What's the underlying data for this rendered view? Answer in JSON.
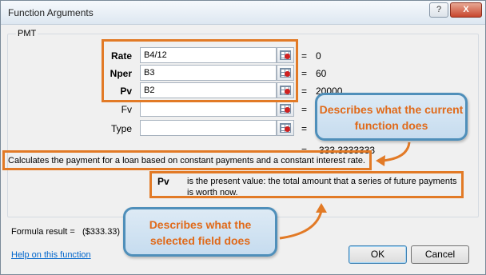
{
  "window": {
    "title": "Function Arguments",
    "help_btn": "?",
    "close_btn": "X"
  },
  "group": {
    "function_name": "PMT"
  },
  "arguments": [
    {
      "label": "Rate",
      "value": "B4/12",
      "result": "0",
      "bold": true
    },
    {
      "label": "Nper",
      "value": "B3",
      "result": "60",
      "bold": true
    },
    {
      "label": "Pv",
      "value": "B2",
      "result": "20000",
      "bold": true
    },
    {
      "label": "Fv",
      "value": "",
      "result": "",
      "bold": false
    },
    {
      "label": "Type",
      "value": "",
      "result": "",
      "bold": false
    }
  ],
  "function_result": "-333.3333333",
  "function_description": "Calculates the payment for a loan based on constant payments and a constant interest rate.",
  "argument_description": {
    "name": "Pv",
    "text": "is the present value: the total amount that a series of future payments is worth now."
  },
  "formula_result": {
    "label": "Formula result =",
    "value": "($333.33)"
  },
  "help_link": "Help on this function",
  "buttons": {
    "ok": "OK",
    "cancel": "Cancel"
  },
  "callouts": {
    "current_function": "Describes what the current function does",
    "selected_field": "Describes what the selected field does"
  },
  "colors": {
    "highlight": "#e27a26",
    "callout_border": "#4f8fba",
    "callout_text": "#e06a1a"
  }
}
